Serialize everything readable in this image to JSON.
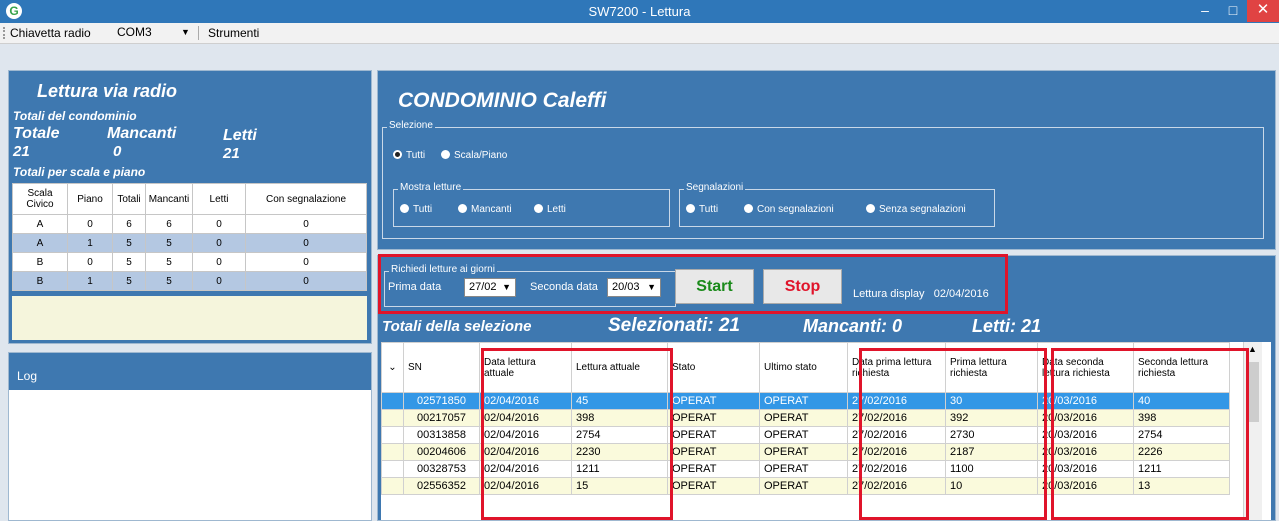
{
  "window": {
    "title": "SW7200 - Lettura",
    "app_icon": "G",
    "minimize": "–",
    "maximize": "□",
    "close": "✕"
  },
  "menubar": {
    "radio_label": "Chiavetta radio",
    "port": "COM3",
    "tools": "Strumenti"
  },
  "left": {
    "heading": "Lettura via radio",
    "totals_label": "Totali del condominio",
    "col_totale": "Totale",
    "col_mancanti": "Mancanti",
    "col_letti": "Letti",
    "val_totale": "21",
    "val_mancanti": "0",
    "val_letti": "21",
    "per_scala_label": "Totali per scala e piano",
    "table": {
      "headers": [
        "Scala Civico",
        "Piano",
        "Totali",
        "Mancanti",
        "Letti",
        "Con segnalazione"
      ],
      "rows": [
        [
          "A",
          "0",
          "6",
          "6",
          "0",
          "0"
        ],
        [
          "A",
          "1",
          "5",
          "5",
          "0",
          "0"
        ],
        [
          "B",
          "0",
          "5",
          "5",
          "0",
          "0"
        ],
        [
          "B",
          "1",
          "5",
          "5",
          "0",
          "0"
        ]
      ]
    },
    "log_label": "Log"
  },
  "condominio": {
    "title": "CONDOMINIO Caleffi",
    "selezione_legend": "Selezione",
    "sel_tutti": "Tutti",
    "sel_scala": "Scala/Piano",
    "mostra_legend": "Mostra letture",
    "mostra": [
      "Tutti",
      "Mancanti",
      "Letti"
    ],
    "segnal_legend": "Segnalazioni",
    "segnal": [
      "Tutti",
      "Con segnalazioni",
      "Senza segnalazioni"
    ]
  },
  "richiesta": {
    "legend": "Richiedi letture ai giorni",
    "prima_label": "Prima data",
    "prima_val": "27/02",
    "seconda_label": "Seconda data",
    "seconda_val": "20/03",
    "start": "Start",
    "stop": "Stop",
    "display_label": "Lettura display",
    "display_val": "02/04/2016",
    "start_color": "#1a8a1a",
    "stop_color": "#e0142a"
  },
  "selection_totals": {
    "label": "Totali della selezione",
    "selezionati": "Selezionati: 21",
    "mancanti": "Mancanti: 0",
    "letti": "Letti: 21"
  },
  "grid": {
    "headers": [
      "SN",
      "Data lettura attuale",
      "Lettura attuale",
      "Stato",
      "Ultimo stato",
      "Data prima lettura richiesta",
      "Prima lettura richiesta",
      "Data seconda lettura richiesta",
      "Seconda lettura richiesta"
    ],
    "rows": [
      [
        "02571850",
        "02/04/2016",
        "45",
        "OPERAT",
        "OPERAT",
        "27/02/2016",
        "30",
        "20/03/2016",
        "40"
      ],
      [
        "00217057",
        "02/04/2016",
        "398",
        "OPERAT",
        "OPERAT",
        "27/02/2016",
        "392",
        "20/03/2016",
        "398"
      ],
      [
        "00313858",
        "02/04/2016",
        "2754",
        "OPERAT",
        "OPERAT",
        "27/02/2016",
        "2730",
        "20/03/2016",
        "2754"
      ],
      [
        "00204606",
        "02/04/2016",
        "2230",
        "OPERAT",
        "OPERAT",
        "27/02/2016",
        "2187",
        "20/03/2016",
        "2226"
      ],
      [
        "00328753",
        "02/04/2016",
        "1211",
        "OPERAT",
        "OPERAT",
        "27/02/2016",
        "1100",
        "20/03/2016",
        "1211"
      ],
      [
        "02556352",
        "02/04/2016",
        "15",
        "OPERAT",
        "OPERAT",
        "27/02/2016",
        "10",
        "20/03/2016",
        "13"
      ]
    ]
  }
}
